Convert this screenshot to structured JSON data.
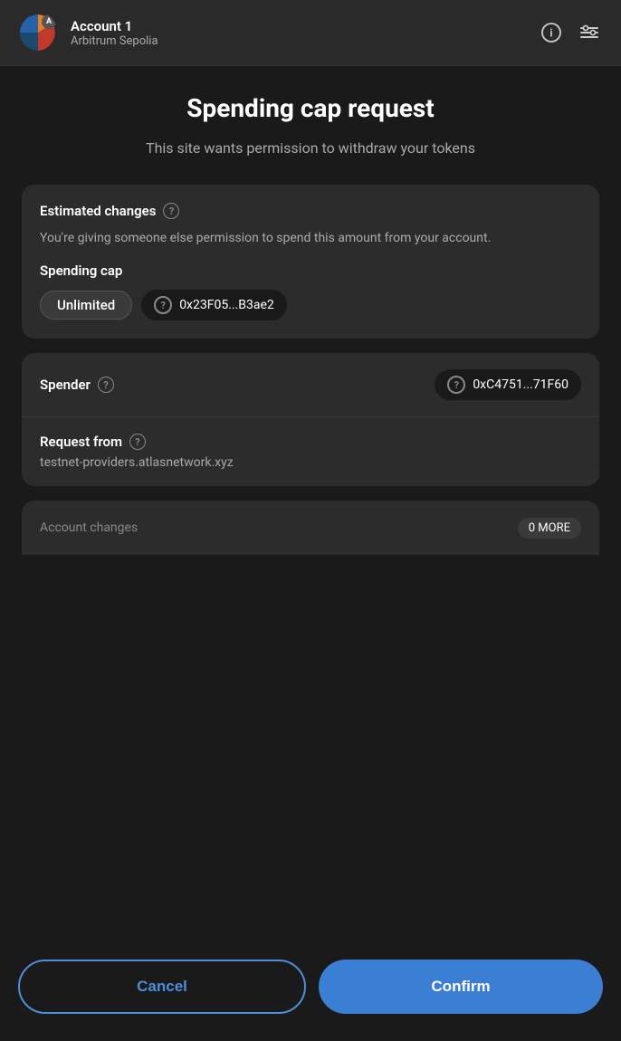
{
  "header": {
    "account_name": "Account 1",
    "network": "Arbitrum Sepolia",
    "avatar_letter": "A"
  },
  "page": {
    "title": "Spending cap request",
    "subtitle": "This site wants permission to withdraw your tokens"
  },
  "estimated_changes": {
    "section_title": "Estimated changes",
    "description": "You're giving someone else permission to spend this amount from your account.",
    "spending_cap_label": "Spending cap",
    "amount": "Unlimited",
    "token_address": "0x23F05...B3ae2"
  },
  "spender": {
    "label": "Spender",
    "address": "0xC4751...71F60"
  },
  "request_from": {
    "label": "Request from",
    "url": "testnet-providers.atlasnetwork.xyz"
  },
  "partial_row": {
    "text": "Account changes",
    "badge": "0 MORE"
  },
  "footer": {
    "cancel_label": "Cancel",
    "confirm_label": "Confirm"
  }
}
